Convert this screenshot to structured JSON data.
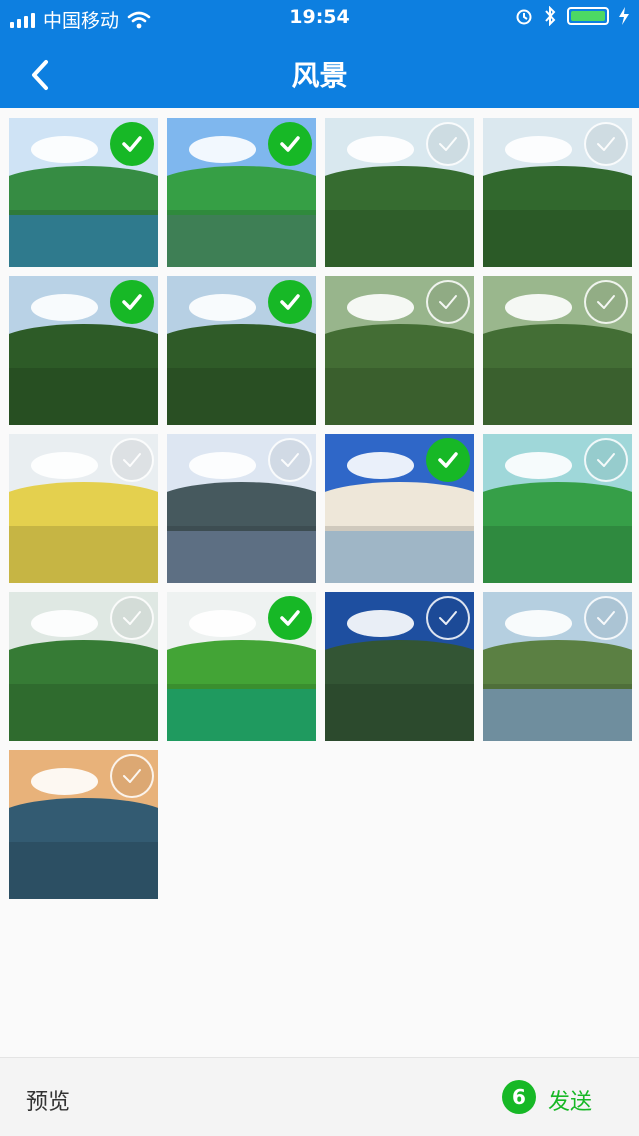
{
  "status_bar": {
    "carrier": "中国移动",
    "time": "19:54",
    "battery_level": 1.0,
    "icons": [
      "signal-icon",
      "wifi-icon",
      "alarm-icon",
      "bluetooth-icon",
      "battery-icon",
      "charging-icon"
    ]
  },
  "nav": {
    "title": "风景",
    "back_icon": "chevron-left-icon"
  },
  "colors": {
    "accent": "#0d7fe0",
    "selected": "#17b826"
  },
  "photos": [
    {
      "selected": true,
      "sky": "#cfe3f5",
      "land": "#2f7a3a",
      "water": "#2f7a8d"
    },
    {
      "selected": true,
      "sky": "#7fb7ee",
      "land": "#2f8a3c",
      "water": "#3e7f55"
    },
    {
      "selected": false,
      "sky": "#d9e8ef",
      "land": "#2f5e2a",
      "water": null
    },
    {
      "selected": false,
      "sky": "#dbe8ef",
      "land": "#2b5a27",
      "water": null
    },
    {
      "selected": true,
      "sky": "#b9d2e6",
      "land": "#274f22",
      "water": null
    },
    {
      "selected": true,
      "sky": "#b7d0e4",
      "land": "#294f23",
      "water": null
    },
    {
      "selected": false,
      "sky": "#98b58c",
      "land": "#3a5f2d",
      "water": null
    },
    {
      "selected": false,
      "sky": "#9ab78d",
      "land": "#3a602e",
      "water": null
    },
    {
      "selected": false,
      "sky": "#e9eef1",
      "land": "#c6b544",
      "water": null
    },
    {
      "selected": false,
      "sky": "#dde6f2",
      "land": "#3d4d52",
      "water": "#5d6f83"
    },
    {
      "selected": true,
      "sky": "#2f67c8",
      "land": "#cfc9bd",
      "water": "#9fb6c6"
    },
    {
      "selected": false,
      "sky": "#9fd7d9",
      "land": "#2f8a3f",
      "water": null
    },
    {
      "selected": false,
      "sky": "#dfe8e3",
      "land": "#2f6b2e",
      "water": null
    },
    {
      "selected": true,
      "sky": "#eef2f1",
      "land": "#3a8f2f",
      "water": "#1f9a5f"
    },
    {
      "selected": false,
      "sky": "#1e4fa0",
      "land": "#2c4a2d",
      "water": null
    },
    {
      "selected": false,
      "sky": "#b5cfe0",
      "land": "#4f6f3a",
      "water": "#6f8e9e"
    },
    {
      "selected": false,
      "sky": "#e8b27a",
      "land": "#2c4f63",
      "water": null
    }
  ],
  "footer": {
    "preview_label": "预览",
    "selected_count": "6",
    "send_label": "发送"
  }
}
